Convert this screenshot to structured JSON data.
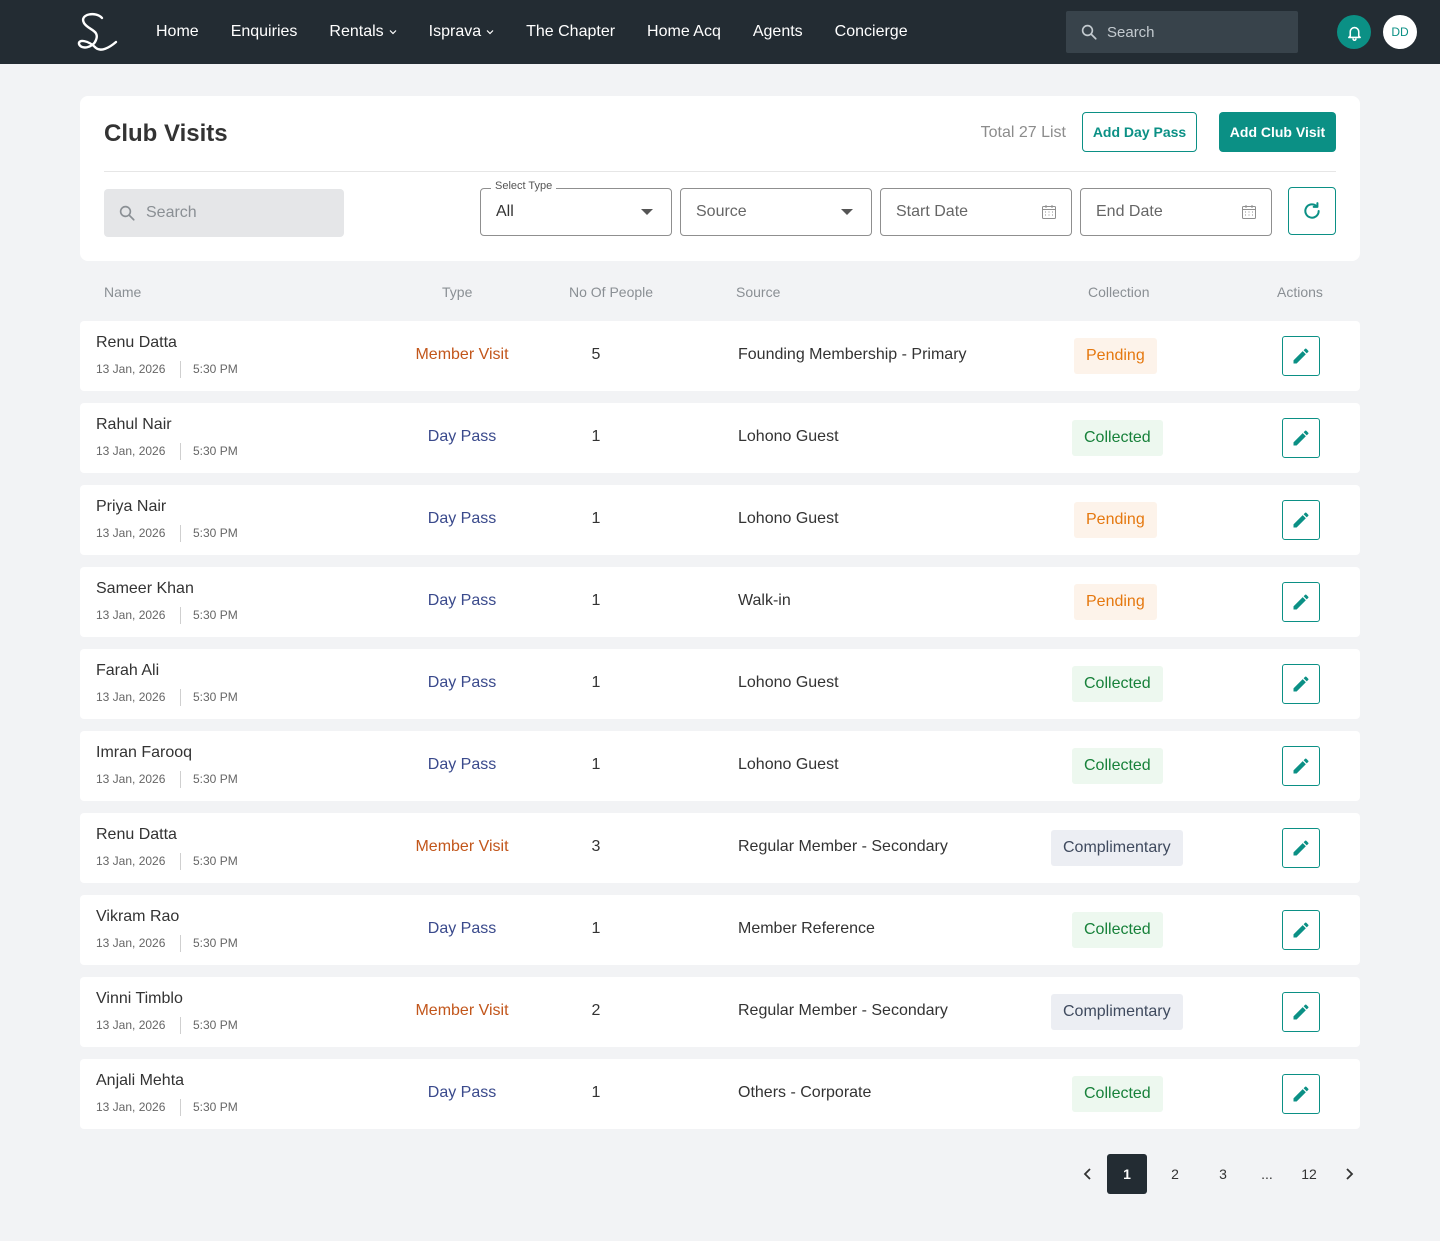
{
  "nav": {
    "items": [
      {
        "label": "Home",
        "dropdown": false
      },
      {
        "label": "Enquiries",
        "dropdown": false
      },
      {
        "label": "Rentals",
        "dropdown": true
      },
      {
        "label": "Isprava",
        "dropdown": true
      },
      {
        "label": "The Chapter",
        "dropdown": false
      },
      {
        "label": "Home Acq",
        "dropdown": false
      },
      {
        "label": "Agents",
        "dropdown": false
      },
      {
        "label": "Concierge",
        "dropdown": false
      }
    ],
    "search_placeholder": "Search",
    "avatar_initials": "DD"
  },
  "header": {
    "title": "Club Visits",
    "total_text": "Total 27 List",
    "add_day_pass_label": "Add Day Pass",
    "add_club_visit_label": "Add Club Visit"
  },
  "filters": {
    "search_placeholder": "Search",
    "type_legend": "Select Type",
    "type_value": "All",
    "source_placeholder": "Source",
    "start_date_placeholder": "Start Date",
    "end_date_placeholder": "End Date"
  },
  "table": {
    "columns": [
      "Name",
      "Type",
      "No Of People",
      "Source",
      "Collection",
      "Actions"
    ],
    "rows": [
      {
        "name": "Renu Datta",
        "date": "13 Jan, 2026",
        "time": "5:30 PM",
        "type": "Member Visit",
        "people": "5",
        "source": "Founding Membership - Primary",
        "collection": "Pending"
      },
      {
        "name": "Rahul Nair",
        "date": "13 Jan, 2026",
        "time": "5:30 PM",
        "type": "Day Pass",
        "people": "1",
        "source": "Lohono Guest",
        "collection": "Collected"
      },
      {
        "name": "Priya Nair",
        "date": "13 Jan, 2026",
        "time": "5:30 PM",
        "type": "Day Pass",
        "people": "1",
        "source": "Lohono Guest",
        "collection": "Pending"
      },
      {
        "name": "Sameer Khan",
        "date": "13 Jan, 2026",
        "time": "5:30 PM",
        "type": "Day Pass",
        "people": "1",
        "source": "Walk-in",
        "collection": "Pending"
      },
      {
        "name": "Farah Ali",
        "date": "13 Jan, 2026",
        "time": "5:30 PM",
        "type": "Day Pass",
        "people": "1",
        "source": "Lohono Guest",
        "collection": "Collected"
      },
      {
        "name": "Imran Farooq",
        "date": "13 Jan, 2026",
        "time": "5:30 PM",
        "type": "Day Pass",
        "people": "1",
        "source": "Lohono Guest",
        "collection": "Collected"
      },
      {
        "name": "Renu Datta",
        "date": "13 Jan, 2026",
        "time": "5:30 PM",
        "type": "Member Visit",
        "people": "3",
        "source": "Regular Member - Secondary",
        "collection": "Complimentary"
      },
      {
        "name": "Vikram Rao",
        "date": "13 Jan, 2026",
        "time": "5:30 PM",
        "type": "Day Pass",
        "people": "1",
        "source": "Member Reference",
        "collection": "Collected"
      },
      {
        "name": "Vinni Timblo",
        "date": "13 Jan, 2026",
        "time": "5:30 PM",
        "type": "Member Visit",
        "people": "2",
        "source": "Regular Member - Secondary",
        "collection": "Complimentary"
      },
      {
        "name": "Anjali Mehta",
        "date": "13 Jan, 2026",
        "time": "5:30 PM",
        "type": "Day Pass",
        "people": "1",
        "source": "Others - Corporate",
        "collection": "Collected"
      }
    ]
  },
  "pagination": {
    "pages": [
      "1",
      "2",
      "3",
      "...",
      "12"
    ],
    "current": "1"
  },
  "colors": {
    "accent": "#0b9085",
    "topbar": "#232c33",
    "member_visit": "#c2561b",
    "day_pass": "#3a4a8c",
    "pending": "#e5780f",
    "collected": "#17813a",
    "complimentary": "#3f4a5e"
  },
  "icons": [
    "logo-icon",
    "chevron-down-icon",
    "search-icon",
    "bell-icon",
    "calendar-icon",
    "refresh-icon",
    "pencil-icon",
    "chevron-left-icon",
    "chevron-right-icon"
  ]
}
